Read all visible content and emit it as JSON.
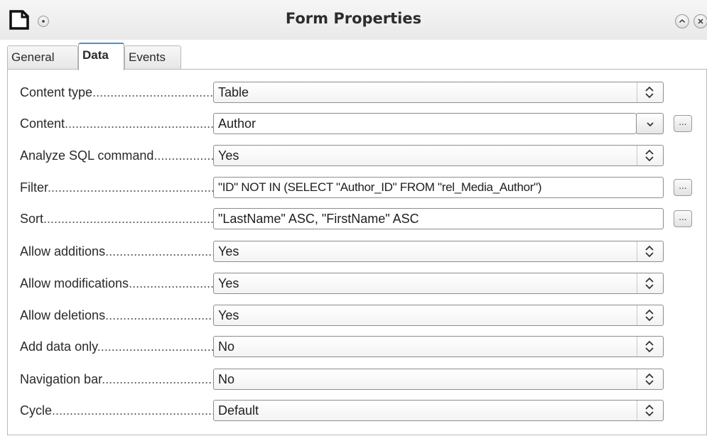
{
  "window": {
    "title": "Form Properties"
  },
  "tabs": [
    {
      "label": "General"
    },
    {
      "label": "Data"
    },
    {
      "label": "Events"
    }
  ],
  "rows": {
    "content_type": {
      "label": "Content type",
      "value": "Table"
    },
    "content": {
      "label": "Content",
      "value": "Author",
      "browse": "..."
    },
    "analyze_sql": {
      "label": "Analyze SQL command",
      "value": "Yes"
    },
    "filter": {
      "label": "Filter",
      "value": "\"ID\" NOT IN (SELECT \"Author_ID\" FROM \"rel_Media_Author\")",
      "browse": "..."
    },
    "sort": {
      "label": "Sort",
      "value": "\"LastName\" ASC, \"FirstName\" ASC",
      "browse": "..."
    },
    "allow_additions": {
      "label": "Allow additions",
      "value": "Yes"
    },
    "allow_modifications": {
      "label": "Allow modifications",
      "value": "Yes"
    },
    "allow_deletions": {
      "label": "Allow deletions",
      "value": "Yes"
    },
    "add_data_only": {
      "label": "Add data only",
      "value": "No"
    },
    "navigation_bar": {
      "label": "Navigation bar",
      "value": "No"
    },
    "cycle": {
      "label": "Cycle",
      "value": "Default"
    }
  }
}
